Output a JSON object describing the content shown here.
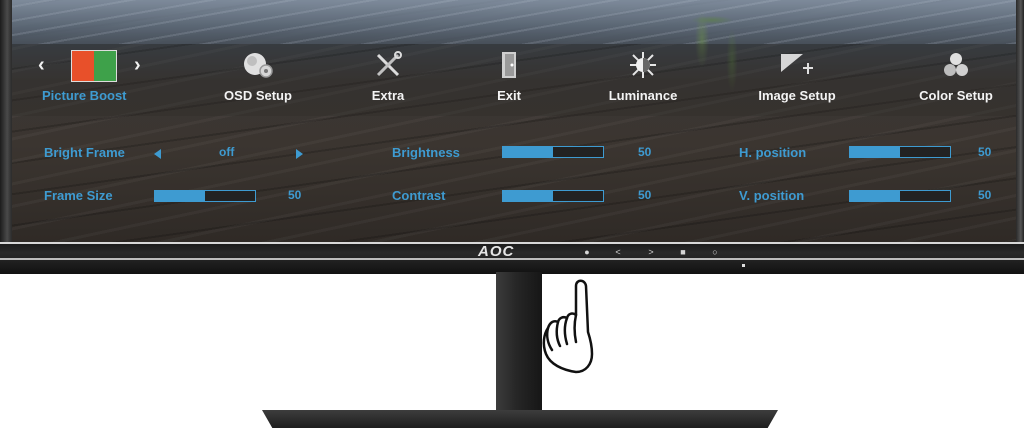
{
  "menu": {
    "items": [
      {
        "label": "Picture Boost",
        "icon": "picture-boost-icon",
        "selected": true
      },
      {
        "label": "OSD Setup",
        "icon": "osd-setup-icon"
      },
      {
        "label": "Extra",
        "icon": "extra-icon"
      },
      {
        "label": "Exit",
        "icon": "exit-icon"
      },
      {
        "label": "Luminance",
        "icon": "luminance-icon"
      },
      {
        "label": "Image Setup",
        "icon": "image-setup-icon"
      },
      {
        "label": "Color Setup",
        "icon": "color-setup-icon"
      }
    ]
  },
  "settings": {
    "bright_frame": {
      "label": "Bright Frame",
      "value": "off"
    },
    "frame_size": {
      "label": "Frame Size",
      "value": "50",
      "level": 0.5
    },
    "brightness": {
      "label": "Brightness",
      "value": "50",
      "level": 0.5
    },
    "contrast": {
      "label": "Contrast",
      "value": "50",
      "level": 0.5
    },
    "h_position": {
      "label": "H. position",
      "value": "50",
      "level": 0.5
    },
    "v_position": {
      "label": "V. position",
      "value": "50",
      "level": 0.5
    }
  },
  "bezel": {
    "brand": "AOC",
    "buttons": [
      "●",
      "<",
      ">",
      "■",
      "○"
    ]
  },
  "colors": {
    "accent": "#3e9bd1",
    "menu_text": "#f4f4f4",
    "pb_orange": "#e8502a",
    "pb_green": "#3ea14a"
  }
}
